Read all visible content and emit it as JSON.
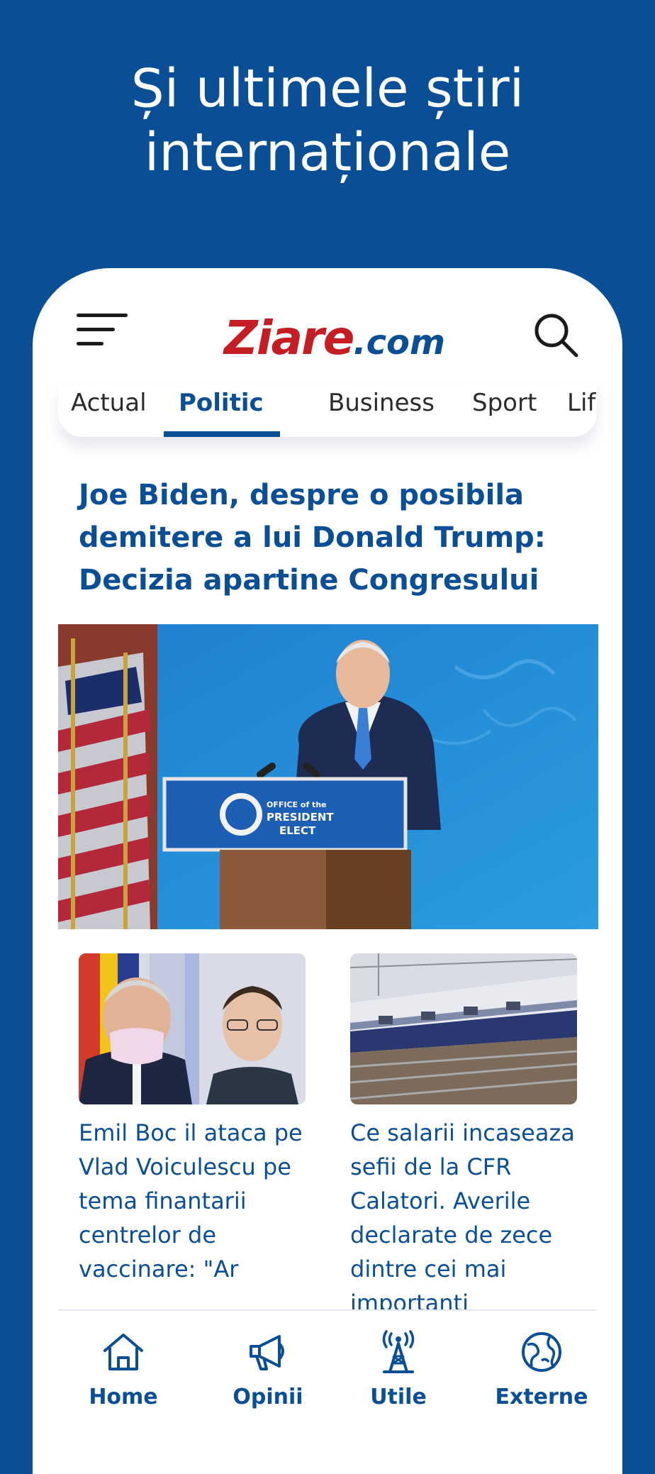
{
  "promo": {
    "line1": "Și ultimele știri",
    "line2": "internaționale"
  },
  "header": {
    "logo_main": "Ziare",
    "logo_tld": ".com",
    "menu_icon": "hamburger-menu-icon",
    "search_icon": "search-icon"
  },
  "tabs": [
    {
      "label": "Actual",
      "active": false
    },
    {
      "label": "Politic",
      "active": true
    },
    {
      "label": "Business",
      "active": false
    },
    {
      "label": "Sport",
      "active": false
    },
    {
      "label": "Life",
      "active": false
    }
  ],
  "featured": {
    "title": "Joe Biden, despre o posibila demitere a lui Donald Trump: Decizia apartine Congresului",
    "image_podium_text_line1": "OFFICE of the",
    "image_podium_text_line2": "PRESIDENT",
    "image_podium_text_line3": "ELECT"
  },
  "articles": [
    {
      "title": "Emil Boc il ataca pe Vlad Voiculescu pe tema finantarii centrelor de vaccinare: \"Ar"
    },
    {
      "title": "Ce salarii incaseaza sefii de la CFR Calatori. Averile declarate de zece dintre cei mai importanti"
    }
  ],
  "bottom_nav": [
    {
      "label": "Home",
      "icon": "home-icon"
    },
    {
      "label": "Opinii",
      "icon": "megaphone-icon"
    },
    {
      "label": "Utile",
      "icon": "antenna-tower-icon"
    },
    {
      "label": "Externe",
      "icon": "globe-icon"
    }
  ],
  "colors": {
    "brand_blue": "#0a4f96",
    "logo_red": "#c41e24",
    "background": "#0a4f96"
  }
}
